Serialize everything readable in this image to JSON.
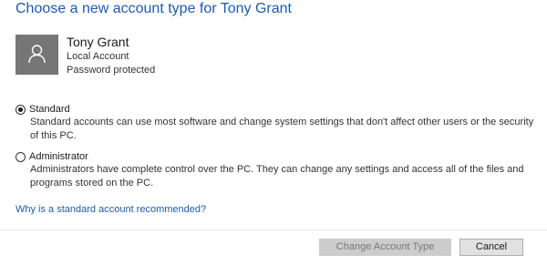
{
  "dialog": {
    "title": "Choose a new account type for Tony Grant"
  },
  "user": {
    "name": "Tony Grant",
    "account_type": "Local Account",
    "password_status": "Password protected",
    "avatar_icon": "person-icon"
  },
  "options": [
    {
      "label": "Standard",
      "description": "Standard accounts can use most software and change system settings that don't affect other users or the security of this PC.",
      "selected": true
    },
    {
      "label": "Administrator",
      "description": "Administrators have complete control over the PC. They can change any settings and access all of the files and programs stored on the PC.",
      "selected": false
    }
  ],
  "help_link": "Why is a standard account recommended?",
  "buttons": {
    "change_label": "Change Account Type",
    "cancel_label": "Cancel"
  },
  "colors": {
    "accent": "#1f5aa6",
    "avatar_bg": "#767676",
    "disabled_button": "#cccccc"
  }
}
